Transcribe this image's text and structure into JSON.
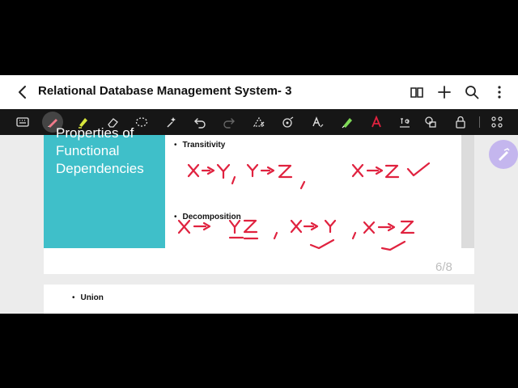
{
  "window": {
    "title": "Relational Database Management System- 3"
  },
  "toolbar": {
    "tools": [
      "keyboard-icon",
      "pen-icon",
      "highlighter-icon",
      "eraser-icon",
      "lasso-icon",
      "magic-select-icon",
      "undo-icon",
      "redo-icon",
      "shape-icon",
      "tape-icon",
      "text-icon",
      "pen-color-icon",
      "handwriting-to-text-icon",
      "image-to-text-icon",
      "shapes-icon",
      "lock-icon",
      "more-icon"
    ]
  },
  "slide": {
    "heading": "Properties of Functional Dependencies",
    "bullet1": "Transitivity",
    "bullet2": "Decomposition",
    "page_number": "6/8",
    "handwriting": {
      "line1": "X->Y , Y->Z , X->Z ✓",
      "line2": "X->YZ , X->Y , X->Z"
    }
  },
  "slide2": {
    "bullet1": "Union"
  },
  "colors": {
    "teal": "#3fbfc9",
    "ink": "#e0223f",
    "toolbar": "#161616",
    "fab": "#c4b6ee"
  }
}
